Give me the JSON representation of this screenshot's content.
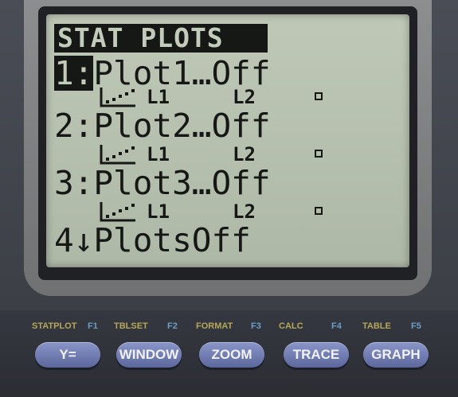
{
  "screen": {
    "title": "STAT PLOTS",
    "items": [
      {
        "num": "1:",
        "label": "Plot1…Off",
        "xlist": "L1",
        "ylist": "L2"
      },
      {
        "num": "2:",
        "label": "Plot2…Off",
        "xlist": "L1",
        "ylist": "L2"
      },
      {
        "num": "3:",
        "label": "Plot3…Off",
        "xlist": "L1",
        "ylist": "L2"
      }
    ],
    "item4": {
      "num": "4",
      "arrow": "↓",
      "label": "PlotsOff"
    },
    "selected_item": 1,
    "plot_icon": "scatter-plot-icon",
    "mark_icon": "square-mark-icon"
  },
  "keys": [
    {
      "second": "STATPLOT",
      "fn": "F1",
      "label": "Y="
    },
    {
      "second": "TBLSET",
      "fn": "F2",
      "label": "WINDOW"
    },
    {
      "second": "FORMAT",
      "fn": "F3",
      "label": "ZOOM"
    },
    {
      "second": "CALC",
      "fn": "F4",
      "label": "TRACE"
    },
    {
      "second": "TABLE",
      "fn": "F5",
      "label": "GRAPH"
    }
  ],
  "colors": {
    "lcd_background": "#b7c0ae",
    "lcd_text": "#161816",
    "second_function": "#b6a75c",
    "function_key": "#6e9dc7",
    "key_face": "#7480b4"
  }
}
